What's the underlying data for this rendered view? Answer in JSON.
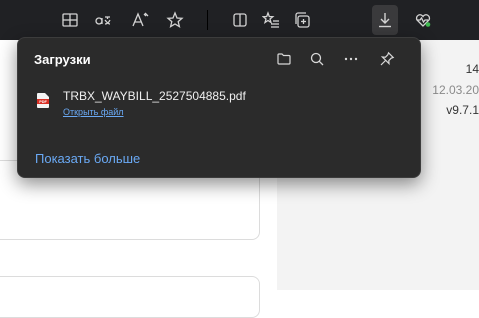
{
  "panel": {
    "title": "Загрузки",
    "file": {
      "name": "TRBX_WAYBILL_2527504885.pdf",
      "open_link": "Открыть файл",
      "icon_label": "PDF"
    },
    "show_more": "Показать больше"
  },
  "page_meta": {
    "line1": "14",
    "line2": "12.03.20",
    "line3": "v9.7.1"
  },
  "toolbar_icons": [
    "split-screen-icon",
    "translate-icon",
    "read-aloud-icon",
    "favorite-star-icon",
    "sidebar-icon",
    "favorites-list-icon",
    "collections-icon",
    "downloads-icon",
    "health-icon"
  ],
  "colors": {
    "panel_bg": "#2b2b2b",
    "link": "#6aa9f4",
    "toolbar_bg": "#202124"
  }
}
